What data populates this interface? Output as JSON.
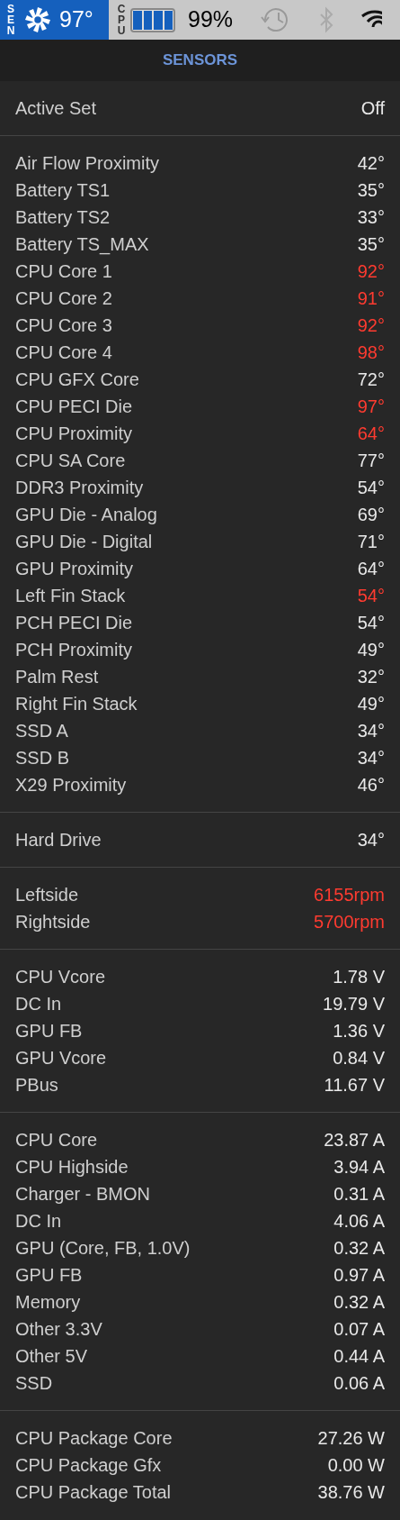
{
  "menu_bar": {
    "sen_label": "SEN",
    "temperature": "97°",
    "cpu_label": "CPU",
    "battery": "99%"
  },
  "header": {
    "title": "SENSORS"
  },
  "sections": [
    {
      "rows": [
        {
          "label": "Active Set",
          "value": "Off",
          "alert": false
        }
      ]
    },
    {
      "rows": [
        {
          "label": "Air Flow Proximity",
          "value": "42°",
          "alert": false
        },
        {
          "label": "Battery TS1",
          "value": "35°",
          "alert": false
        },
        {
          "label": "Battery TS2",
          "value": "33°",
          "alert": false
        },
        {
          "label": "Battery TS_MAX",
          "value": "35°",
          "alert": false
        },
        {
          "label": "CPU Core 1",
          "value": "92°",
          "alert": true
        },
        {
          "label": "CPU Core 2",
          "value": "91°",
          "alert": true
        },
        {
          "label": "CPU Core 3",
          "value": "92°",
          "alert": true
        },
        {
          "label": "CPU Core 4",
          "value": "98°",
          "alert": true
        },
        {
          "label": "CPU GFX Core",
          "value": "72°",
          "alert": false
        },
        {
          "label": "CPU PECI Die",
          "value": "97°",
          "alert": true
        },
        {
          "label": "CPU Proximity",
          "value": "64°",
          "alert": true
        },
        {
          "label": "CPU SA Core",
          "value": "77°",
          "alert": false
        },
        {
          "label": "DDR3 Proximity",
          "value": "54°",
          "alert": false
        },
        {
          "label": "GPU Die - Analog",
          "value": "69°",
          "alert": false
        },
        {
          "label": "GPU Die - Digital",
          "value": "71°",
          "alert": false
        },
        {
          "label": "GPU Proximity",
          "value": "64°",
          "alert": false
        },
        {
          "label": "Left Fin Stack",
          "value": "54°",
          "alert": true
        },
        {
          "label": "PCH PECI Die",
          "value": "54°",
          "alert": false
        },
        {
          "label": "PCH Proximity",
          "value": "49°",
          "alert": false
        },
        {
          "label": "Palm Rest",
          "value": "32°",
          "alert": false
        },
        {
          "label": "Right Fin Stack",
          "value": "49°",
          "alert": false
        },
        {
          "label": "SSD A",
          "value": "34°",
          "alert": false
        },
        {
          "label": "SSD B",
          "value": "34°",
          "alert": false
        },
        {
          "label": "X29 Proximity",
          "value": "46°",
          "alert": false
        }
      ]
    },
    {
      "rows": [
        {
          "label": "Hard Drive",
          "value": "34°",
          "alert": false
        }
      ]
    },
    {
      "rows": [
        {
          "label": "Leftside",
          "value": "6155rpm",
          "alert": true
        },
        {
          "label": "Rightside",
          "value": "5700rpm",
          "alert": true
        }
      ]
    },
    {
      "rows": [
        {
          "label": "CPU Vcore",
          "value": "1.78 V",
          "alert": false
        },
        {
          "label": "DC In",
          "value": "19.79 V",
          "alert": false
        },
        {
          "label": "GPU FB",
          "value": "1.36 V",
          "alert": false
        },
        {
          "label": "GPU Vcore",
          "value": "0.84 V",
          "alert": false
        },
        {
          "label": "PBus",
          "value": "11.67 V",
          "alert": false
        }
      ]
    },
    {
      "rows": [
        {
          "label": "CPU Core",
          "value": "23.87 A",
          "alert": false
        },
        {
          "label": "CPU Highside",
          "value": "3.94 A",
          "alert": false
        },
        {
          "label": "Charger - BMON",
          "value": "0.31 A",
          "alert": false
        },
        {
          "label": "DC In",
          "value": "4.06 A",
          "alert": false
        },
        {
          "label": "GPU (Core, FB, 1.0V)",
          "value": "0.32 A",
          "alert": false
        },
        {
          "label": "GPU FB",
          "value": "0.97 A",
          "alert": false
        },
        {
          "label": "Memory",
          "value": "0.32 A",
          "alert": false
        },
        {
          "label": "Other 3.3V",
          "value": "0.07 A",
          "alert": false
        },
        {
          "label": "Other 5V",
          "value": "0.44 A",
          "alert": false
        },
        {
          "label": "SSD",
          "value": "0.06 A",
          "alert": false
        }
      ]
    },
    {
      "rows": [
        {
          "label": "CPU Package Core",
          "value": "27.26 W",
          "alert": false
        },
        {
          "label": "CPU Package Gfx",
          "value": "0.00 W",
          "alert": false
        },
        {
          "label": "CPU Package Total",
          "value": "38.76 W",
          "alert": false
        }
      ]
    }
  ]
}
